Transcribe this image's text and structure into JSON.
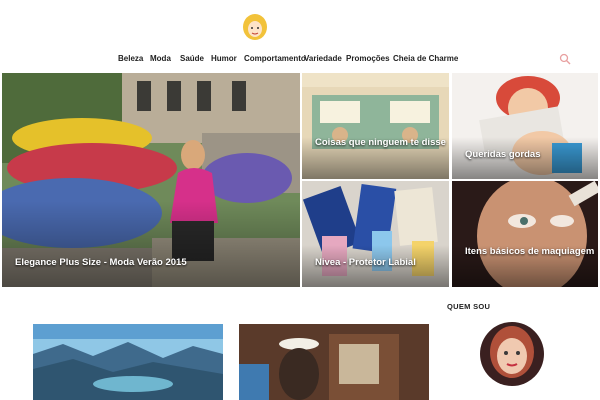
{
  "nav": {
    "items": [
      {
        "label": "Beleza"
      },
      {
        "label": "Moda"
      },
      {
        "label": "Saúde"
      },
      {
        "label": "Humor"
      },
      {
        "label": "Comportamento"
      },
      {
        "label": "Variedade"
      },
      {
        "label": "Promoções"
      },
      {
        "label": "Cheia de Charme"
      }
    ],
    "search_icon": "search-icon"
  },
  "featured": {
    "main": {
      "title": "Elegance Plus Size - Moda Verão 2015"
    },
    "top_middle": {
      "title": "Coisas que ninguem te disse"
    },
    "top_right": {
      "title": "Queridas gordas"
    },
    "bottom_middle": {
      "title": "Nivea - Protetor Labial"
    },
    "bottom_right": {
      "title": "Itens básicos de maquiagem"
    }
  },
  "sidebar": {
    "about_title": "QUEM SOU"
  },
  "colors": {
    "accent": "#e8a0a0",
    "text": "#222222"
  }
}
